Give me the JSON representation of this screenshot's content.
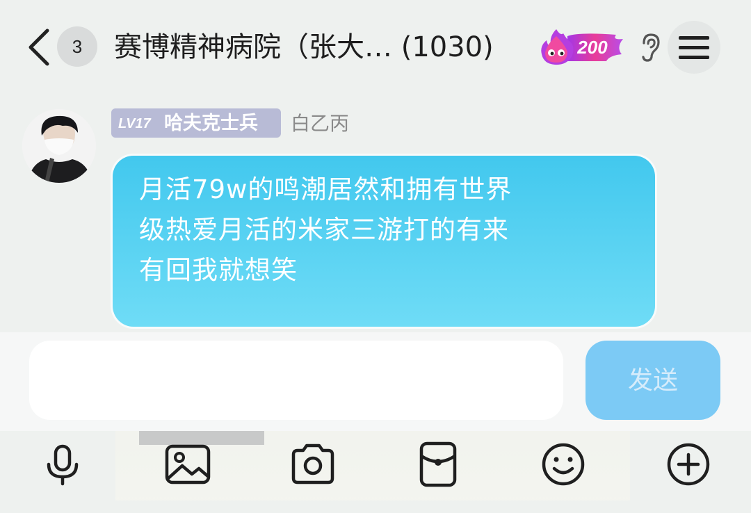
{
  "header": {
    "unread_count": "3",
    "title": "赛博精神病院（张大… (1030)",
    "fire_level": "200"
  },
  "message": {
    "level": "LV17",
    "title_tag": "哈夫克士兵",
    "sender": "白乙丙",
    "text": "月活79w的鸣潮居然和拥有世界\n级热爱月活的米家三游打的有来\n有回我就想笑"
  },
  "composer": {
    "input_value": "",
    "send_label": "发送"
  },
  "toolbar": {
    "icons": [
      "microphone-icon",
      "image-icon",
      "camera-icon",
      "red-packet-icon",
      "emoji-icon",
      "plus-icon"
    ]
  },
  "colors": {
    "bubble": "#4fd0f1",
    "send_button": "#7ccaf5",
    "level_tag": "#b8bbd6",
    "fire": "#e0368a"
  }
}
